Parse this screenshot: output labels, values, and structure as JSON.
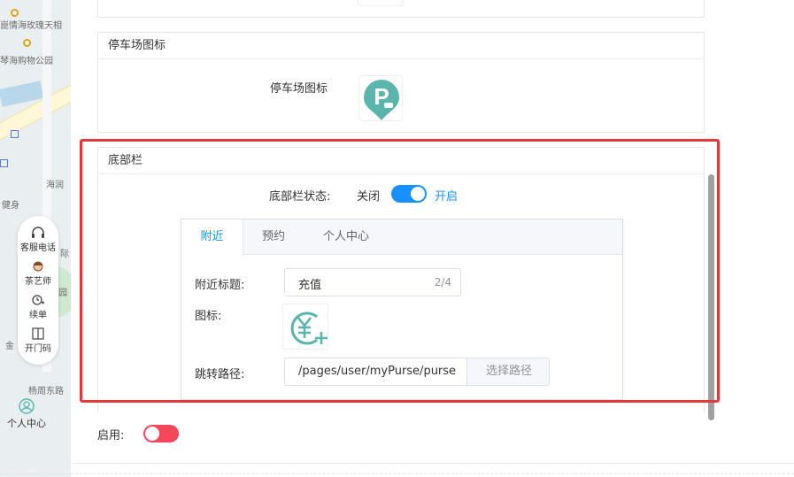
{
  "map": {
    "labels": [
      "崑情海玫瑰天相",
      "琴海购物公园",
      "海润",
      "健身",
      "际",
      "园",
      "金",
      "杨周东路"
    ],
    "quick_actions": [
      {
        "label": "客服电话",
        "icon": "headset-icon"
      },
      {
        "label": "茶艺师",
        "icon": "tea-master-icon"
      },
      {
        "label": "续单",
        "icon": "clock-plus-icon"
      },
      {
        "label": "开门码",
        "icon": "door-icon"
      }
    ],
    "my_center": {
      "label": "个人中心",
      "icon": "user-icon"
    }
  },
  "parking": {
    "header": "停车场图标",
    "label": "停车场图标",
    "icon": "parking-icon",
    "icon_color": "#5bb5ad"
  },
  "bottom_bar": {
    "header": "底部栏",
    "status_label": "底部栏状态:",
    "off_label": "关闭",
    "on_label": "开启",
    "enabled": true,
    "tabs": [
      "附近",
      "预约",
      "个人中心"
    ],
    "active_tab": "附近",
    "title_label": "附近标题:",
    "title_value": "充值",
    "title_count": "2/4",
    "icon_label": "图标:",
    "icon": "yuan-plus-icon",
    "path_label": "跳转路径:",
    "path_value": "/pages/user/myPurse/purse",
    "path_button": "选择路径"
  },
  "enable": {
    "label": "启用:",
    "enabled": false
  },
  "colors": {
    "accent": "#1890ff",
    "highlight": "#e0393e",
    "toggle_off": "#f5475b",
    "icon_teal": "#5bb5ad"
  }
}
